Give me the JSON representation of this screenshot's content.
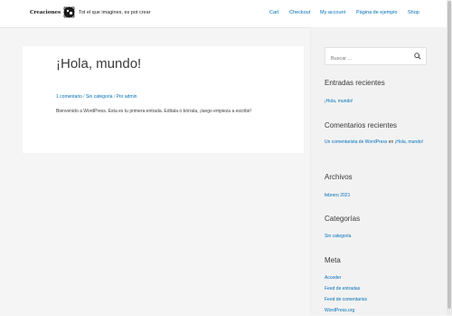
{
  "header": {
    "logo_text": "Creaciones",
    "tagline": "Tot el que imagines, es pot crear",
    "nav": [
      "Cart",
      "Checkout",
      "My account",
      "Página de ejemplo",
      "Shop"
    ]
  },
  "post": {
    "title": "¡Hola, mundo!",
    "meta_comments": "1 comentario",
    "meta_sep1": "/",
    "meta_category": "Sin categoría",
    "meta_sep2": "/",
    "meta_author_prefix": "Por",
    "meta_author": "admin",
    "excerpt": "Bienvenido a WordPress. Esta es tu primera entrada. Edítala o bórrala, ¡luego empieza a escribir!"
  },
  "sidebar": {
    "search_placeholder": "Buscar ...",
    "recent_posts_title": "Entradas recientes",
    "recent_posts": [
      "¡Hola, mundo!"
    ],
    "recent_comments_title": "Comentarios recientes",
    "recent_comment": {
      "author": "Un comentarista de WordPress",
      "connector": "en",
      "post": "¡Hola, mundo!"
    },
    "archives_title": "Archivos",
    "archives": [
      "febrero 2021"
    ],
    "categories_title": "Categorías",
    "categories": [
      "Sin categoría"
    ],
    "meta_title": "Meta",
    "meta_links": [
      "Acceder",
      "Feed de entradas",
      "Feed de comentarios",
      "WordPress.org"
    ]
  },
  "colors": {
    "link": "#0170b9",
    "text": "#3a3a3a",
    "background": "#f5f5f5"
  }
}
